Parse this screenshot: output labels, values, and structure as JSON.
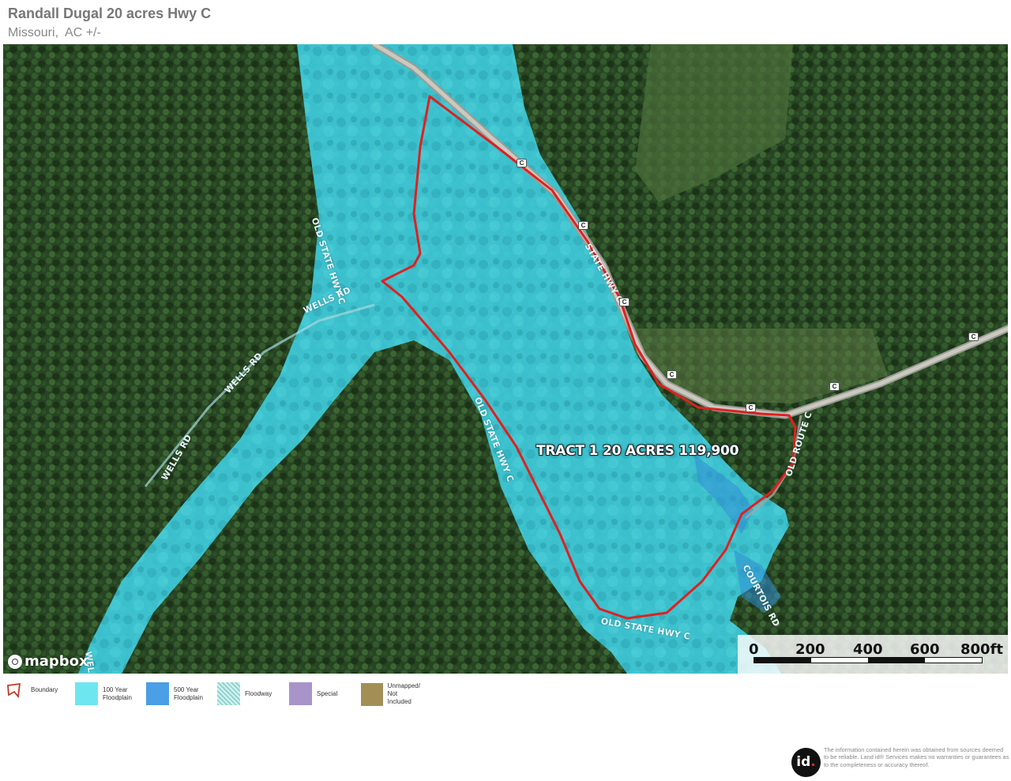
{
  "header": {
    "title": "Randall Dugal 20 acres Hwy C",
    "subtitle": "Missouri,  AC +/-"
  },
  "map": {
    "tract_label": "TRACT 1 20 ACRES 119,900",
    "road_labels": {
      "old_state_hwy_c_north": "OLD STATE HWY C",
      "wells_rd_1": "WELLS RD",
      "wells_rd_2": "WELLS RD",
      "wells_rd_3": "WELLS RD",
      "state_hwy_c": "STATE HWY C",
      "old_state_hwy_c_mid": "OLD STATE HWY C",
      "old_route_c": "OLD ROUTE C",
      "courtois_rd": "COURTOIS RD",
      "old_state_hwy_c_south": "OLD STATE HWY C",
      "wells_rd_cut": "WEL"
    },
    "shield_text": "C",
    "colors": {
      "boundary": "#e02020",
      "floodplain_100": "#3fd6e8",
      "floodplain_500": "#2f8ed6",
      "forest": "#24401f",
      "road": "#b9b9b0"
    }
  },
  "attribution": {
    "logo_text": "mapbox"
  },
  "scale": {
    "ticks": [
      "0",
      "200",
      "400",
      "600",
      "800ft"
    ]
  },
  "legend": {
    "items": [
      {
        "label": "Boundary",
        "color": "#c0392b",
        "icon": "boundary-icon"
      },
      {
        "label": "100 Year\nFloodplain",
        "color": "#6ee6f0"
      },
      {
        "label": "500 Year\nFloodplain",
        "color": "#4a9fe6"
      },
      {
        "label": "Floodway",
        "color": "#8fd4cf"
      },
      {
        "label": "Special",
        "color": "#a894c9"
      },
      {
        "label": "Unmapped/\nNot Included",
        "color": "#a38f55"
      }
    ]
  },
  "footer": {
    "logo_main": "id",
    "logo_dot": ".",
    "disclaimer": "The information contained herein was obtained from sources deemed to be reliable. Land id® Services makes no warranties or guarantees as to the completeness or accuracy thereof."
  }
}
